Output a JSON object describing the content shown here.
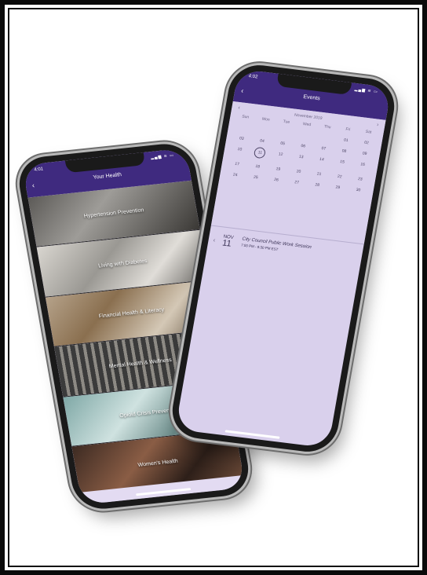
{
  "left_phone": {
    "status_time": "4:01",
    "status_icons": "▂▄▆ ≋ ▭",
    "back": "‹",
    "title": "Your Health",
    "right": "",
    "categories": [
      {
        "label": "Hypertension Prevention"
      },
      {
        "label": "Living with Diabetes"
      },
      {
        "label": "Financial Health & Literacy"
      },
      {
        "label": "Mental Health & Wellness"
      },
      {
        "label": "Opioid Crisis Prevention"
      },
      {
        "label": "Women's Health"
      }
    ]
  },
  "right_phone": {
    "status_time": "4:02",
    "status_icons": "▂▄▆ ≋ ▭",
    "back": "‹",
    "title": "Events",
    "right": "",
    "calendar": {
      "month": "November 2019",
      "prev": "‹",
      "next": "›",
      "weekdays": [
        "Sun",
        "Mon",
        "Tue",
        "Wed",
        "Thu",
        "Fri",
        "Sat"
      ],
      "weeks": [
        [
          "",
          "",
          "",
          "",
          "",
          "01",
          "02"
        ],
        [
          "03",
          "04",
          "05",
          "06",
          "07",
          "08",
          "09"
        ],
        [
          "10",
          "11",
          "12",
          "13",
          "14",
          "15",
          "16"
        ],
        [
          "17",
          "18",
          "19",
          "20",
          "21",
          "22",
          "23"
        ],
        [
          "24",
          "25",
          "26",
          "27",
          "28",
          "29",
          "30"
        ]
      ],
      "selected_day": "11"
    },
    "event": {
      "chevron": "‹",
      "month": "NOV",
      "day": "11",
      "title": "City Council Public Work Session",
      "time": "7:00 PM - 9:30 PM EST"
    }
  }
}
